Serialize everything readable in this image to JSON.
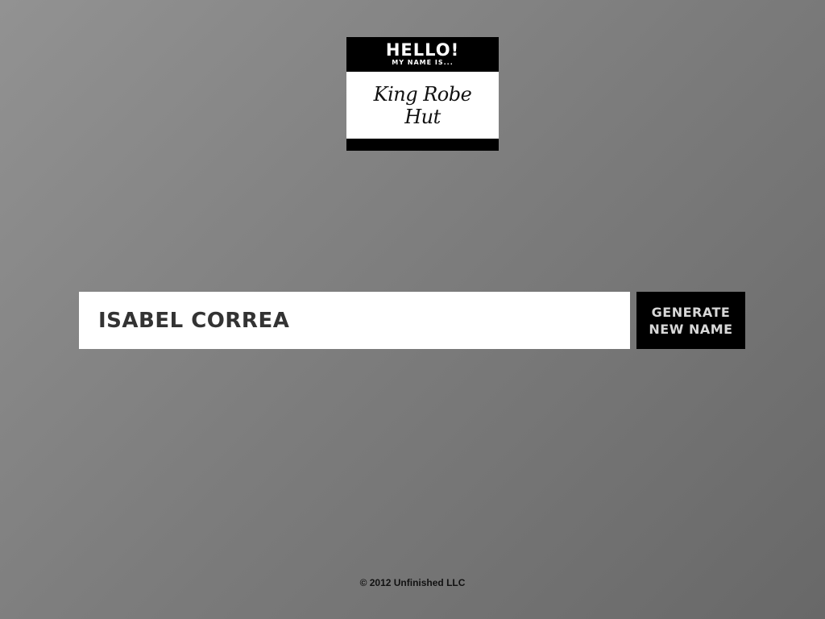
{
  "badge": {
    "hello": "HELLO!",
    "subtitle": "MY NAME IS...",
    "name": "King Robe Hut"
  },
  "name_field": {
    "value": "ISABEL CORREA"
  },
  "generate_button": {
    "label": "GENERATE NEW NAME"
  },
  "footer": {
    "copyright": "© 2012 Unfinished LLC"
  }
}
